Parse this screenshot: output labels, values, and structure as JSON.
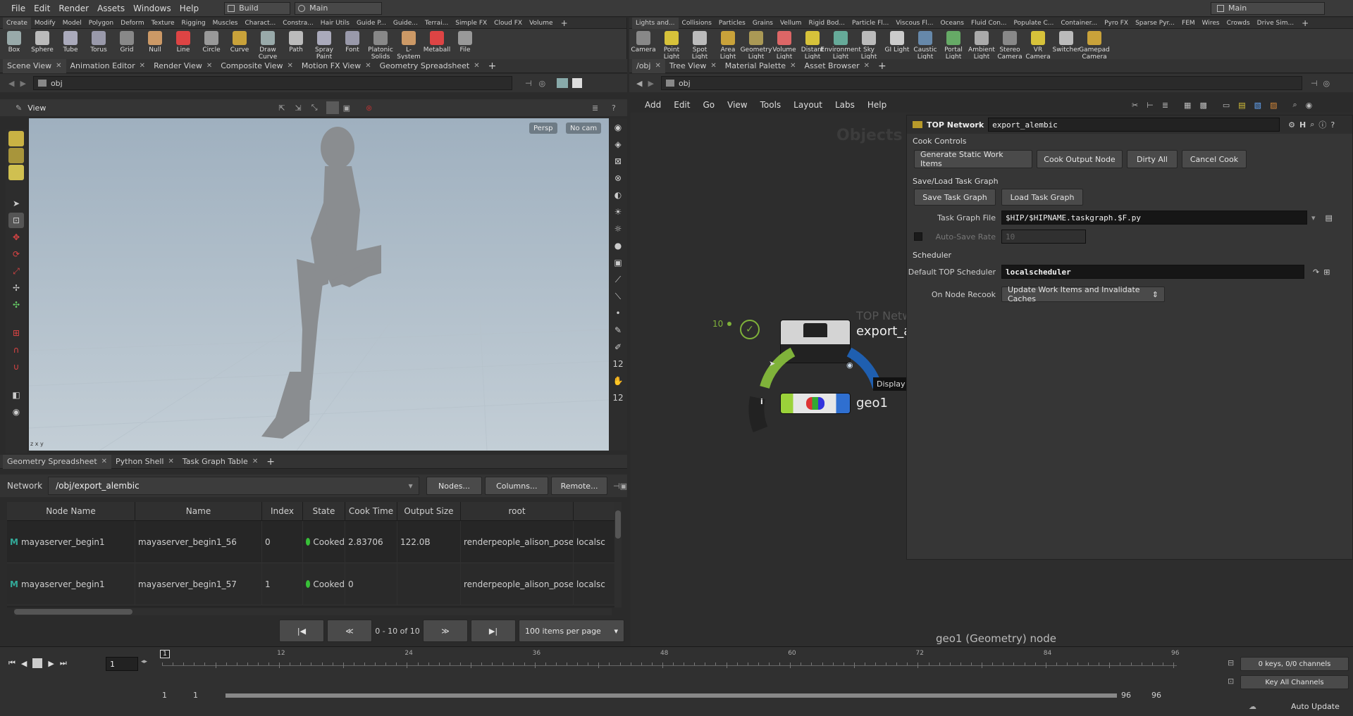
{
  "menu": [
    "File",
    "Edit",
    "Render",
    "Assets",
    "Windows",
    "Help"
  ],
  "desktop_left": "Build",
  "desktop_main": "Main",
  "desktop_right": "Main",
  "shelf_tabs_left": [
    "Create",
    "Modify",
    "Model",
    "Polygon",
    "Deform",
    "Texture",
    "Rigging",
    "Muscles",
    "Charact...",
    "Constra...",
    "Hair Utils",
    "Guide P...",
    "Guide...",
    "Terrai...",
    "Simple FX",
    "Cloud FX",
    "Volume"
  ],
  "shelf_tools_left": [
    "Box",
    "Sphere",
    "Tube",
    "Torus",
    "Grid",
    "Null",
    "Line",
    "Circle",
    "Curve",
    "Draw Curve",
    "Path",
    "Spray Paint",
    "Font",
    "Platonic Solids",
    "L-System",
    "Metaball",
    "File"
  ],
  "shelf_tabs_right": [
    "Lights and...",
    "Collisions",
    "Particles",
    "Grains",
    "Vellum",
    "Rigid Bod...",
    "Particle Fl...",
    "Viscous Fl...",
    "Oceans",
    "Fluid Con...",
    "Populate C...",
    "Container...",
    "Pyro FX",
    "Sparse Pyr...",
    "FEM",
    "Wires",
    "Crowds",
    "Drive Sim..."
  ],
  "shelf_tools_right": [
    "Camera",
    "Point Light",
    "Spot Light",
    "Area Light",
    "Geometry Light",
    "Volume Light",
    "Distant Light",
    "Environment Light",
    "Sky Light",
    "GI Light",
    "Caustic Light",
    "Portal Light",
    "Ambient Light",
    "Stereo Camera",
    "VR Camera",
    "Switcher",
    "Gamepad Camera"
  ],
  "pane_tabs_left": [
    "Scene View",
    "Animation Editor",
    "Render View",
    "Composite View",
    "Motion FX View",
    "Geometry Spreadsheet"
  ],
  "pane_tabs_right": [
    "/obj",
    "Tree View",
    "Material Palette",
    "Asset Browser"
  ],
  "path_left": "obj",
  "path_right": "obj",
  "viewport": {
    "title": "View",
    "persp": "Persp",
    "cam": "No cam"
  },
  "bottom_tabs": [
    "Geometry Spreadsheet",
    "Python Shell",
    "Task Graph Table"
  ],
  "network": {
    "label": "Network",
    "path": "/obj/export_alembic",
    "buttons": [
      "Nodes...",
      "Columns...",
      "Remote..."
    ]
  },
  "table": {
    "headers": [
      "Node Name",
      "Name",
      "Index",
      "State",
      "Cook Time",
      "Output Size",
      "root",
      ""
    ],
    "rows": [
      [
        "mayaserver_begin1",
        "mayaserver_begin1_56",
        "0",
        "Cooked",
        "2.83706",
        "122.0B",
        "renderpeople_alison_posed",
        "localsc"
      ],
      [
        "mayaserver_begin1",
        "mayaserver_begin1_57",
        "1",
        "Cooked",
        "0",
        "",
        "renderpeople_alison_posed",
        "localsc"
      ]
    ]
  },
  "pager": {
    "range": "0 - 10 of 10",
    "per_page": "100 items per page"
  },
  "net_menu": [
    "Add",
    "Edit",
    "Go",
    "View",
    "Tools",
    "Layout",
    "Labs",
    "Help"
  ],
  "net_watermark": "Objects",
  "nodes": {
    "count": "10",
    "top_type": "TOP Netw",
    "top_name": "export_a",
    "geo_name": "geo1",
    "display_tip": "Display",
    "status": "geo1 (Geometry) node"
  },
  "params": {
    "type": "TOP Network",
    "name": "export_alembic",
    "cook_controls": "Cook Controls",
    "cook_buttons": [
      "Generate Static Work Items",
      "Cook Output Node",
      "Dirty All",
      "Cancel Cook"
    ],
    "saveload": "Save/Load Task Graph",
    "save_btn": "Save Task Graph",
    "load_btn": "Load Task Graph",
    "task_file_label": "Task Graph File",
    "task_file": "$HIP/$HIPNAME.taskgraph.$F.py",
    "autosave_label": "Auto-Save Rate",
    "autosave_value": "10",
    "scheduler": "Scheduler",
    "default_sched_label": "Default TOP Scheduler",
    "default_sched": "localscheduler",
    "recook_label": "On Node Recook",
    "recook_value": "Update Work Items and Invalidate Caches"
  },
  "timeline": {
    "frame": "1",
    "ticks": [
      "1",
      "12",
      "24",
      "36",
      "48",
      "60",
      "72",
      "84",
      "96"
    ],
    "start": "1",
    "start2": "1",
    "end": "96",
    "end2": "96",
    "keys": "0 keys, 0/0 channels",
    "key_all": "Key All Channels",
    "auto_update": "Auto Update"
  },
  "colors": {
    "accent": "#f5c518",
    "cooked": "#38c038",
    "viewport_top": "#9aaab8",
    "viewport_bottom": "#c4cfd6"
  }
}
